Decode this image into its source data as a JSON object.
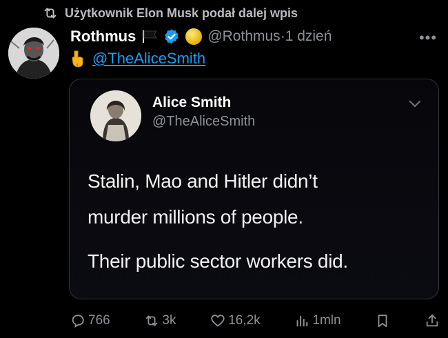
{
  "retweet_context": {
    "text": "Użytkownik Elon Musk podał dalej wpis",
    "icon": "retweet-icon"
  },
  "tweet": {
    "author_name": "Rothmus",
    "handle": "@Rothmus",
    "separator": "·",
    "time": "1 dzień",
    "more_label": "•••",
    "reply_emoji_icon": "pointing-down-hand-icon",
    "mention": "@TheAliceSmith"
  },
  "quoted_tweet": {
    "author_name": "Alice Smith",
    "handle": "@TheAliceSmith",
    "lines": [
      "Stalin, Mao and Hitler didn’t",
      "murder millions of people.",
      "Their public sector workers did."
    ]
  },
  "actions": {
    "replies": "766",
    "reposts": "3k",
    "likes": "16,2k",
    "views": "1mln"
  },
  "colors": {
    "accent": "#1d9bf0",
    "muted": "#8b9197",
    "background": "#000000"
  }
}
